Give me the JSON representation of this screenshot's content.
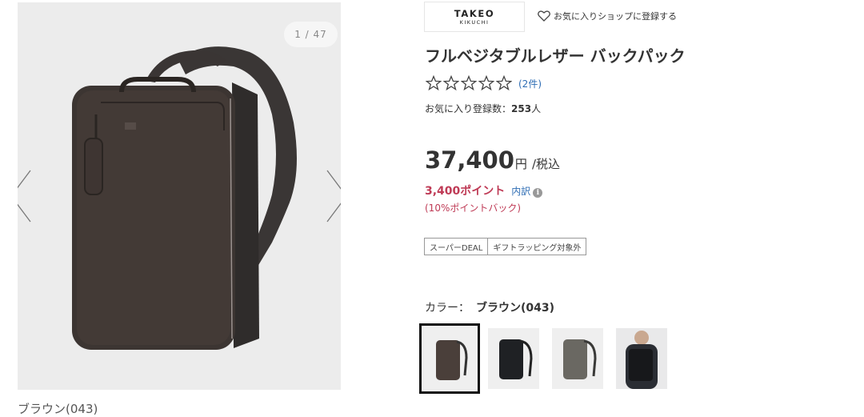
{
  "gallery": {
    "counter": "1 / 47",
    "caption": "ブラウン(043)"
  },
  "shop": {
    "logo_line1": "TAKEO",
    "logo_line2": "KIKUCHI",
    "favorite_label": "お気に入りショップに登録する"
  },
  "product": {
    "title": "フルベジタブルレザー バックパック",
    "rating_stars": 0,
    "rating_max": 5,
    "review_count": "(2件)",
    "favorite_label": "お気に入り登録数：",
    "favorite_count": "253",
    "favorite_unit": "人",
    "price": "37,400",
    "price_unit": "円",
    "price_tax": "/税込",
    "points": "3,400ポイント",
    "points_detail": "内訳",
    "points_back": "(10%ポイントバック)",
    "tags": [
      "スーパーDEAL",
      "ギフトラッピング対象外"
    ],
    "color_label": "カラー：",
    "color_selected": "ブラウン(043)"
  },
  "swatches": [
    {
      "name": "brown",
      "color": "#4a3f3a",
      "selected": true
    },
    {
      "name": "black",
      "color": "#1f2124",
      "selected": false
    },
    {
      "name": "gray",
      "color": "#6a6862",
      "selected": false
    },
    {
      "name": "model",
      "color": "#2a2d33",
      "selected": false
    }
  ],
  "colors": {
    "point_red": "#bf3b56",
    "link_blue": "#2e6db4"
  }
}
